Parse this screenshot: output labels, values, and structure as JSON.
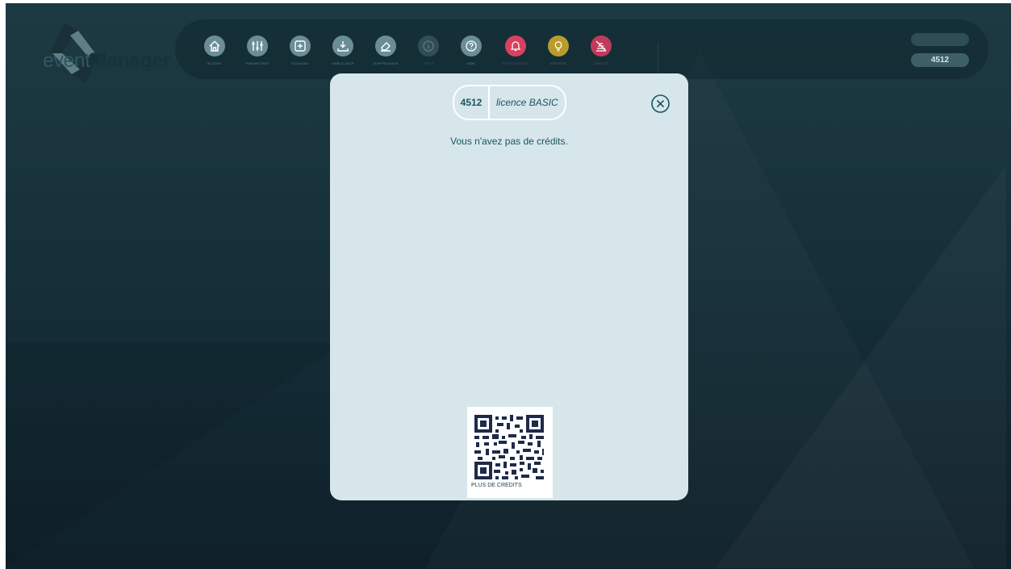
{
  "app": {
    "logo": {
      "part1": "event",
      "part2": "Manager"
    },
    "toolbar": [
      {
        "id": "accueil",
        "label": "ACCUEIL",
        "icon": "home-icon"
      },
      {
        "id": "parametres",
        "label": "PARAMETRES",
        "icon": "sliders-icon"
      },
      {
        "id": "nouveau",
        "label": "NOUVEAU",
        "icon": "plus-square-icon"
      },
      {
        "id": "mise-a-jour",
        "label": "MISE A JOUR",
        "icon": "download-icon"
      },
      {
        "id": "suppression",
        "label": "SUPPRESSION",
        "icon": "eraser-icon"
      },
      {
        "id": "infos",
        "label": "INFOS",
        "icon": "info-icon"
      },
      {
        "id": "aide",
        "label": "AIDE",
        "icon": "question-icon"
      },
      {
        "id": "notifications",
        "label": "NOTIFICATIONS",
        "icon": "bell-icon"
      },
      {
        "id": "astuces",
        "label": "ASTUCES",
        "icon": "lightbulb-icon"
      },
      {
        "id": "credits",
        "label": "CREDITS",
        "icon": "credits-icon"
      }
    ],
    "header_right": {
      "top_pill": "",
      "id": "4512"
    }
  },
  "modal": {
    "badge_number": "4512",
    "license": "licence BASIC",
    "message": "Vous n'avez pas de crédits.",
    "qr_caption": "PLUS DE CREDITS"
  },
  "colors": {
    "accent": "#1a5563",
    "modal_bg": "#d6e6ea",
    "bell": "#d8425f",
    "bulb": "#b89d2c",
    "credits": "#c13a5b"
  }
}
